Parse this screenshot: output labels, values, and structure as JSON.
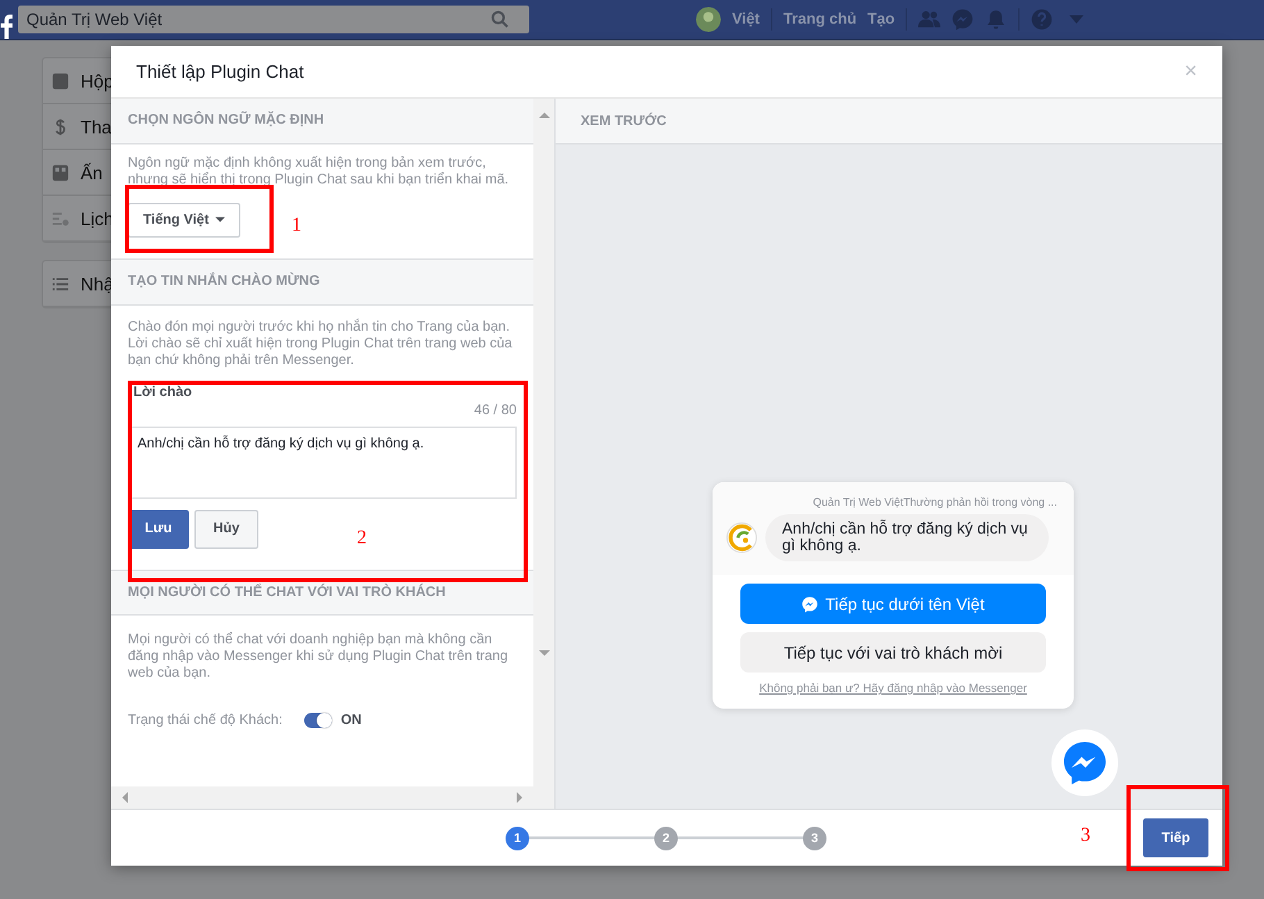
{
  "topbar": {
    "search_value": "Quản Trị Web Việt",
    "user": "Việt",
    "links": [
      "Trang chủ",
      "Tạo"
    ]
  },
  "sidebar": {
    "items": [
      {
        "label": "Hộp",
        "kind": "inbox"
      },
      {
        "label": "Tha",
        "kind": "dollar"
      },
      {
        "label": "Ấn",
        "kind": "grid"
      },
      {
        "label": "Lịch",
        "kind": "list"
      },
      {
        "label": "Nhậ",
        "kind": "menu"
      }
    ]
  },
  "modal": {
    "title": "Thiết lập Plugin Chat",
    "close": "×",
    "language": {
      "heading": "CHỌN NGÔN NGỮ MẶC ĐỊNH",
      "description": "Ngôn ngữ mặc định không xuất hiện trong bản xem trước, nhưng sẽ hiển thị trong Plugin Chat sau khi bạn triển khai mã.",
      "value": "Tiếng Việt"
    },
    "greeting": {
      "heading": "TẠO TIN NHẮN CHÀO MỪNG",
      "description": "Chào đón mọi người trước khi họ nhắn tin cho Trang của bạn. Lời chào sẽ chỉ xuất hiện trong Plugin Chat trên trang web của bạn chứ không phải trên Messenger.",
      "label": "Lời chào",
      "counter": "46 / 80",
      "value": "Anh/chị cần hỗ trợ đăng ký dịch vụ gì không ạ.",
      "save": "Lưu",
      "cancel": "Hủy"
    },
    "guest": {
      "heading": "MỌI NGƯỜI CÓ THỂ CHAT VỚI VAI TRÒ KHÁCH",
      "description": "Mọi người có thể chat với doanh nghiệp bạn mà không cần đăng nhập vào Messenger khi sử dụng Plugin Chat trên trang web của bạn.",
      "toggle_label": "Trạng thái chế độ Khách:",
      "on": true,
      "state_text": "ON"
    },
    "preview": {
      "heading": "XEM TRƯỚC",
      "page_name": "Quản Trị Web Việt",
      "response_time": "Thường phản hồi trong vòng ...",
      "message": "Anh/chị cần hỗ trợ đăng ký dịch vụ gì không ạ.",
      "primary": "Tiếp tục dưới tên Việt",
      "secondary": "Tiếp tục với vai trò khách mời",
      "login_link": "Không phải bạn ư? Hãy đăng nhập vào Messenger"
    },
    "steps": [
      {
        "label": "1",
        "selected": true
      },
      {
        "label": "2",
        "selected": false
      },
      {
        "label": "3",
        "selected": false
      }
    ],
    "next": "Tiếp"
  },
  "annotations": [
    "1",
    "2",
    "3"
  ]
}
